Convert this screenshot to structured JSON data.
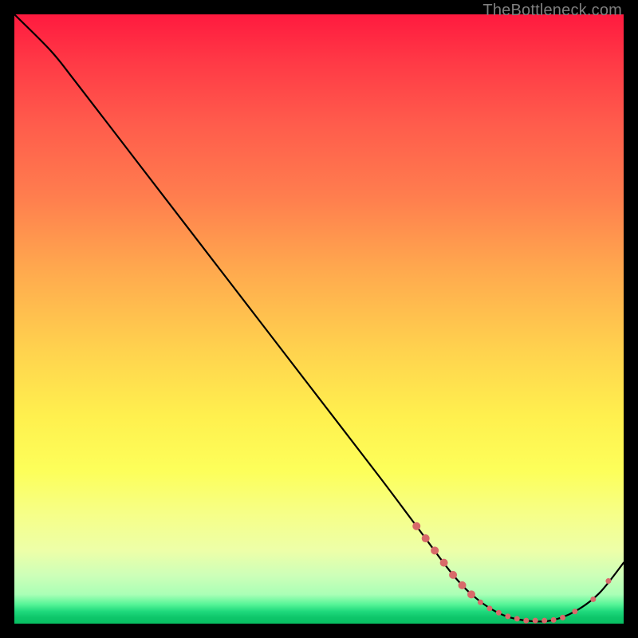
{
  "attribution": "TheBottleneck.com",
  "chart_data": {
    "type": "line",
    "title": "",
    "xlabel": "",
    "ylabel": "",
    "xlim": [
      0,
      100
    ],
    "ylim": [
      0,
      100
    ],
    "grid": false,
    "series": [
      {
        "name": "bottleneck-curve",
        "color": "#000000",
        "x": [
          0,
          6,
          10,
          20,
          30,
          40,
          50,
          60,
          66,
          72,
          76,
          80,
          84,
          88,
          92,
          96,
          100
        ],
        "y": [
          100,
          94,
          89,
          76,
          63,
          50,
          37,
          24,
          16,
          8,
          4,
          1.5,
          0.5,
          0.5,
          2,
          5,
          10
        ]
      }
    ],
    "markers": {
      "name": "highlighted-range",
      "color": "#d86a6a",
      "radius_small": 3.5,
      "radius_large": 5,
      "points": [
        {
          "x": 66,
          "y": 16,
          "r": "large"
        },
        {
          "x": 67.5,
          "y": 14,
          "r": "large"
        },
        {
          "x": 69,
          "y": 12,
          "r": "large"
        },
        {
          "x": 70.5,
          "y": 10,
          "r": "large"
        },
        {
          "x": 72,
          "y": 8,
          "r": "large"
        },
        {
          "x": 73.5,
          "y": 6.3,
          "r": "large"
        },
        {
          "x": 75,
          "y": 4.8,
          "r": "large"
        },
        {
          "x": 76.5,
          "y": 3.5,
          "r": "small"
        },
        {
          "x": 78,
          "y": 2.5,
          "r": "small"
        },
        {
          "x": 79.5,
          "y": 1.8,
          "r": "small"
        },
        {
          "x": 81,
          "y": 1.2,
          "r": "small"
        },
        {
          "x": 82.5,
          "y": 0.8,
          "r": "small"
        },
        {
          "x": 84,
          "y": 0.5,
          "r": "small"
        },
        {
          "x": 85.5,
          "y": 0.5,
          "r": "small"
        },
        {
          "x": 87,
          "y": 0.5,
          "r": "small"
        },
        {
          "x": 88.5,
          "y": 0.6,
          "r": "small"
        },
        {
          "x": 90,
          "y": 1.0,
          "r": "small"
        },
        {
          "x": 92,
          "y": 2.0,
          "r": "small"
        },
        {
          "x": 95,
          "y": 4.0,
          "r": "small"
        },
        {
          "x": 97.5,
          "y": 7.0,
          "r": "small"
        }
      ]
    }
  }
}
